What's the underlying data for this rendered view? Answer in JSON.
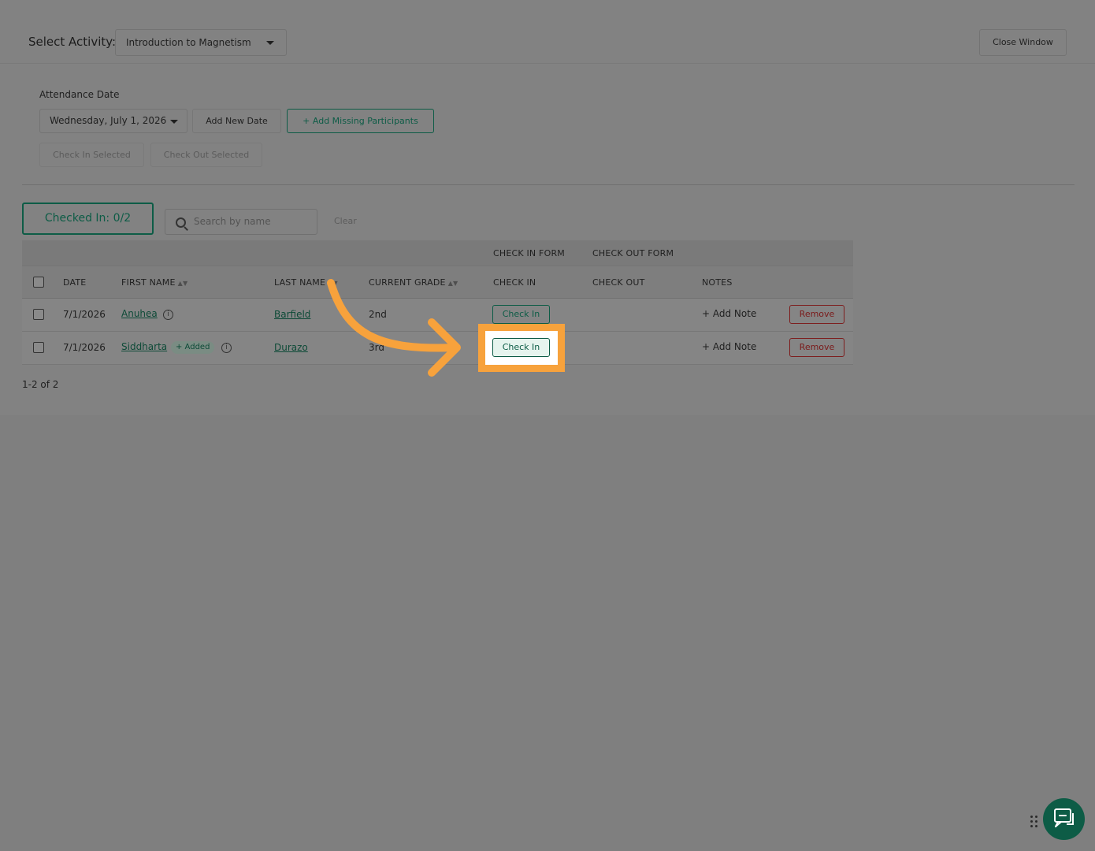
{
  "header": {
    "select_activity_label": "Select Activity:",
    "activity_value": "Introduction to Magnetism",
    "close_window_label": "Close Window"
  },
  "attendance": {
    "date_label": "Attendance Date",
    "date_value": "Wednesday, July 1, 2026",
    "add_new_date_label": "Add New Date",
    "add_missing_label": "+ Add Missing Participants",
    "check_in_selected_label": "Check In Selected",
    "check_out_selected_label": "Check Out Selected"
  },
  "summary": {
    "checked_in_label": "Checked In: 0/2",
    "search_placeholder": "Search by name",
    "clear_label": "Clear"
  },
  "table": {
    "group_headers": {
      "check_in_form": "CHECK IN FORM",
      "check_out_form": "CHECK OUT FORM"
    },
    "headers": {
      "date": "DATE",
      "first_name": "FIRST NAME",
      "last_name": "LAST NAME",
      "current_grade": "CURRENT GRADE",
      "check_in": "CHECK IN",
      "check_out": "CHECK OUT",
      "notes": "NOTES"
    },
    "sort_glyph": "▲▼",
    "rows": [
      {
        "date": "7/1/2026",
        "first_name": "Anuhea",
        "badge": "",
        "last_name": "Barfield",
        "grade": "2nd",
        "check_in_label": "Check In",
        "note_label": "+ Add Note",
        "remove_label": "Remove"
      },
      {
        "date": "7/1/2026",
        "first_name": "Siddharta",
        "badge": "+ Added",
        "last_name": "Durazo",
        "grade": "3rd",
        "check_in_label": "Check In",
        "note_label": "+ Add Note",
        "remove_label": "Remove"
      }
    ],
    "pager": "1-2 of 2"
  },
  "colors": {
    "accent_green": "#0d5c46",
    "highlight_orange": "#f7a23c",
    "remove_red": "#7a1a1a"
  },
  "icons": [
    "search-icon",
    "info-icon",
    "chevron-down-icon",
    "chat-icon",
    "drag-handle-icon",
    "annotation-arrow-icon"
  ]
}
